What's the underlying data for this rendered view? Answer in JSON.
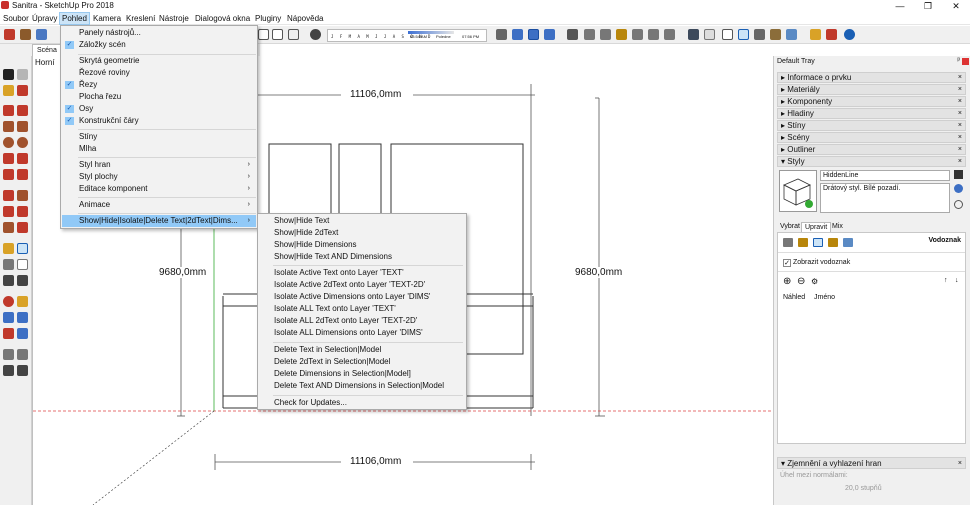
{
  "window": {
    "title": "Sanitra - SketchUp Pro 2018",
    "min": "—",
    "max": "❐",
    "close": "✕"
  },
  "menubar": [
    "Soubor",
    "Úpravy",
    "Pohled",
    "Kamera",
    "Kreslení",
    "Nástroje",
    "Dialogová okna",
    "Pluginy",
    "Nápověda"
  ],
  "active_menu": "Pohled",
  "scene_tab": "Scéna",
  "view_label": "Horní",
  "sun": {
    "months": "J F M A M J J A S O N D",
    "time_start": "03:54 AM",
    "noon": "Poledne",
    "time_end": "07:56 PM"
  },
  "dimensions": {
    "top": "11106,0mm",
    "left": "9680,0mm",
    "right": "9680,0mm",
    "bottom": "11106,0mm"
  },
  "pohled_menu": [
    {
      "label": "Panely nástrojů...",
      "checked": false,
      "arrow": false
    },
    {
      "label": "Záložky scén",
      "checked": true,
      "arrow": false
    },
    {
      "sep": true
    },
    {
      "label": "Skrytá geometrie",
      "checked": false,
      "arrow": false
    },
    {
      "label": "Řezové roviny",
      "checked": false,
      "arrow": false
    },
    {
      "label": "Řezy",
      "checked": true,
      "arrow": false
    },
    {
      "label": "Plocha řezu",
      "checked": false,
      "arrow": false
    },
    {
      "label": "Osy",
      "checked": true,
      "arrow": false
    },
    {
      "label": "Konstrukční čáry",
      "checked": true,
      "arrow": false
    },
    {
      "sep": true
    },
    {
      "label": "Stíny",
      "checked": false,
      "arrow": false
    },
    {
      "label": "Mlha",
      "checked": false,
      "arrow": false
    },
    {
      "sep": true
    },
    {
      "label": "Styl hran",
      "checked": false,
      "arrow": true
    },
    {
      "label": "Styl plochy",
      "checked": false,
      "arrow": true
    },
    {
      "label": "Editace komponent",
      "checked": false,
      "arrow": true
    },
    {
      "sep": true
    },
    {
      "label": "Animace",
      "checked": false,
      "arrow": true
    },
    {
      "sep": true
    },
    {
      "label": "Show|Hide|Isolate|Delete Text|2dText|Dims...",
      "checked": false,
      "arrow": true,
      "highlight": true
    }
  ],
  "submenu": [
    {
      "label": "Show|Hide Text"
    },
    {
      "label": "Show|Hide 2dText"
    },
    {
      "label": "Show|Hide Dimensions"
    },
    {
      "label": "Show|Hide Text AND Dimensions"
    },
    {
      "sep": true
    },
    {
      "label": "Isolate Active Text onto Layer 'TEXT'"
    },
    {
      "label": "Isolate Active 2dText onto Layer 'TEXT-2D'"
    },
    {
      "label": "Isolate Active Dimensions onto Layer 'DIMS'"
    },
    {
      "label": "Isolate ALL Text onto Layer 'TEXT'"
    },
    {
      "label": "Isolate ALL 2dText onto Layer 'TEXT-2D'"
    },
    {
      "label": "Isolate ALL Dimensions onto Layer 'DIMS'"
    },
    {
      "sep": true
    },
    {
      "label": "Delete Text in Selection|Model"
    },
    {
      "label": "Delete 2dText in Selection|Model"
    },
    {
      "label": "Delete Dimensions in Selection|Model]"
    },
    {
      "label": "Delete Text AND Dimensions in Selection|Model"
    },
    {
      "sep": true
    },
    {
      "label": "Check for Updates..."
    }
  ],
  "tray": {
    "title": "Default Tray",
    "pin": "ᵖ",
    "panels": [
      "Informace o prvku",
      "Materiály",
      "Komponenty",
      "Hladiny",
      "Stíny",
      "Scény",
      "Outliner"
    ],
    "styles_panel": "Styly",
    "style_name": "HiddenLine",
    "style_desc": "Drátový styl. Bílé pozadí.",
    "subtabs": [
      "Vybrat",
      "Upravit",
      "Mix"
    ],
    "active_subtab": "Upravit",
    "watermark_label": "Vodoznak",
    "show_watermark": "Zobrazit vodoznak",
    "col_preview": "Náhled",
    "col_name": "Jméno",
    "smoothing": "Zjemnění a vyhlazení hran",
    "normals_label": "Úhel mezi normálami:",
    "normals_value": "20,0 stupňů"
  },
  "colors": {
    "menu_highlight": "#91c9f7",
    "active_menu_bg": "#cce4f7",
    "axis_red": "#d44",
    "axis_green": "#3a3"
  }
}
